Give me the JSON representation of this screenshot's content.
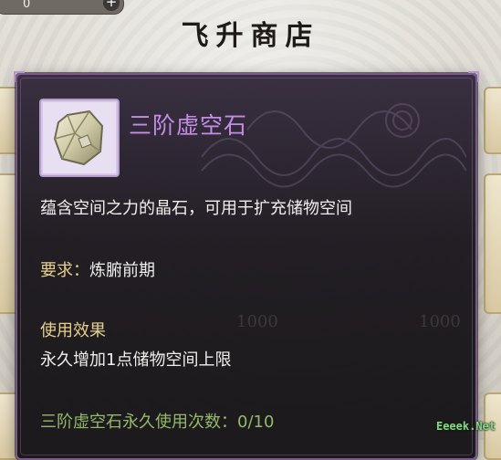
{
  "currency": {
    "value": "0",
    "plus": "+"
  },
  "shop": {
    "title": "飞升商店"
  },
  "tooltip": {
    "item_name": "三阶虚空石",
    "description": "蕴含空间之力的晶石，可用于扩充储物空间",
    "requirement_label": "要求：",
    "requirement_value": "炼腑前期",
    "effect_title": "使用效果",
    "effect_text": "永久增加1点储物空间上限",
    "usage_text": "三阶虚空石永久使用次数：0/10"
  },
  "background_prices": [
    "1000",
    "1000"
  ],
  "watermark": "Eeeek.Net",
  "colors": {
    "item_name": "#c48de6",
    "label_gold": "#e6cf8e",
    "usage_green": "#94b86b",
    "panel_border": "#7a5a8c"
  },
  "icons": {
    "item": "void-stone-icon"
  }
}
